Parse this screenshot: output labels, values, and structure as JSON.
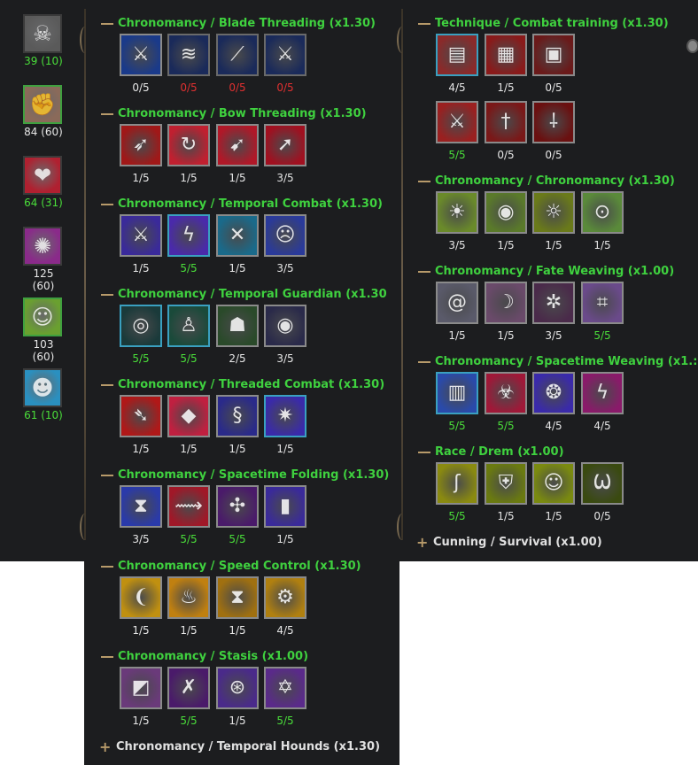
{
  "stats": [
    {
      "label": "39 (10)",
      "color": "green",
      "icon": "skull-emblem-icon",
      "bg": "#5a5a5a",
      "selected": false
    },
    {
      "label": "84 (60)",
      "color": "white",
      "icon": "fist-icon",
      "bg": "#8a6a5a",
      "selected": true
    },
    {
      "label": "64 (31)",
      "color": "green",
      "icon": "heart-drop-icon",
      "bg": "#b02030",
      "selected": false
    },
    {
      "label": "125 (60)",
      "color": "white",
      "icon": "magic-burst-icon",
      "bg": "#8a2a8a",
      "selected": false
    },
    {
      "label": "103 (60)",
      "color": "white",
      "icon": "meditating-figure-icon",
      "bg": "#6aa030",
      "selected": true
    },
    {
      "label": "61 (10)",
      "color": "green",
      "icon": "hooded-figure-icon",
      "bg": "#2a90c0",
      "selected": false
    }
  ],
  "left_categories": [
    {
      "title": "Chronomancy / Blade Threading (x1.30)",
      "talents": [
        {
          "icon": "sword-slash-icon",
          "value": "0/5",
          "color": "white",
          "bg": "#1a3a8a",
          "border": "#8a8a8a"
        },
        {
          "icon": "blade-wave-icon",
          "value": "0/5",
          "color": "red",
          "bg": "#1a2a5a",
          "border": "#6a6a6a"
        },
        {
          "icon": "twin-blades-icon",
          "value": "0/5",
          "color": "red",
          "bg": "#1a2a5a",
          "border": "#6a6a6a"
        },
        {
          "icon": "spinning-sword-icon",
          "value": "0/5",
          "color": "red",
          "bg": "#1a2a5a",
          "border": "#6a6a6a"
        }
      ]
    },
    {
      "title": "Chronomancy / Bow Threading (x1.30)",
      "talents": [
        {
          "icon": "archer-icon",
          "value": "1/5",
          "color": "white",
          "bg": "#a01818",
          "border": "#8a8a8a"
        },
        {
          "icon": "arrow-orbit-icon",
          "value": "1/5",
          "color": "white",
          "bg": "#c02030",
          "border": "#8a8a8a"
        },
        {
          "icon": "arrow-volley-icon",
          "value": "1/5",
          "color": "white",
          "bg": "#b01828",
          "border": "#8a8a8a"
        },
        {
          "icon": "arrow-strike-icon",
          "value": "3/5",
          "color": "white",
          "bg": "#a01020",
          "border": "#8a8a8a"
        }
      ]
    },
    {
      "title": "Chronomancy / Temporal Combat (x1.30)",
      "talents": [
        {
          "icon": "blue-sword-icon",
          "value": "1/5",
          "color": "white",
          "bg": "#3a2a9a",
          "border": "#8a8a8a"
        },
        {
          "icon": "lightning-claw-icon",
          "value": "5/5",
          "color": "green",
          "bg": "#4a2aaa",
          "border": "#3aa0c0"
        },
        {
          "icon": "crossed-blades-icon",
          "value": "1/5",
          "color": "white",
          "bg": "#1a6a8a",
          "border": "#8a8a8a"
        },
        {
          "icon": "spirit-face-icon",
          "value": "3/5",
          "color": "white",
          "bg": "#2a3a9a",
          "border": "#8a8a8a"
        }
      ]
    },
    {
      "title": "Chronomancy / Temporal Guardian (x1.30",
      "talents": [
        {
          "icon": "orbit-swirl-icon",
          "value": "5/5",
          "color": "green",
          "bg": "#1a3a3a",
          "border": "#3aa0c0"
        },
        {
          "icon": "glowing-figure-icon",
          "value": "5/5",
          "color": "green",
          "bg": "#1a4a3a",
          "border": "#3aa0c0"
        },
        {
          "icon": "green-mask-icon",
          "value": "2/5",
          "color": "white",
          "bg": "#2a4a2a",
          "border": "#8a8a8a"
        },
        {
          "icon": "watching-eye-icon",
          "value": "3/5",
          "color": "white",
          "bg": "#2a2a4a",
          "border": "#8a8a8a"
        }
      ]
    },
    {
      "title": "Chronomancy / Threaded Combat (x1.30)",
      "talents": [
        {
          "icon": "bow-blade-icon",
          "value": "1/5",
          "color": "white",
          "bg": "#b01818",
          "border": "#8a8a8a"
        },
        {
          "icon": "diamond-sigil-icon",
          "value": "1/5",
          "color": "white",
          "bg": "#c02040",
          "border": "#8a8a8a"
        },
        {
          "icon": "serpent-blade-icon",
          "value": "1/5",
          "color": "white",
          "bg": "#2a2a8a",
          "border": "#8a8a8a"
        },
        {
          "icon": "star-burst-icon",
          "value": "1/5",
          "color": "white",
          "bg": "#3a2aaa",
          "border": "#3aa0c0"
        }
      ]
    },
    {
      "title": "Chronomancy / Spacetime Folding (x1.30)",
      "talents": [
        {
          "icon": "hourglass-portal-icon",
          "value": "3/5",
          "color": "white",
          "bg": "#2a3aaa",
          "border": "#8a8a8a"
        },
        {
          "icon": "streak-icon",
          "value": "5/5",
          "color": "green",
          "bg": "#a01828",
          "border": "#8a8a8a"
        },
        {
          "icon": "scatter-arrows-icon",
          "value": "5/5",
          "color": "green",
          "bg": "#4a1a6a",
          "border": "#8a8a8a"
        },
        {
          "icon": "pillar-icon",
          "value": "1/5",
          "color": "white",
          "bg": "#3a2a9a",
          "border": "#8a8a8a"
        }
      ]
    },
    {
      "title": "Chronomancy / Speed Control (x1.30)",
      "talents": [
        {
          "icon": "winged-boot-icon",
          "value": "1/5",
          "color": "white",
          "bg": "#c09010",
          "border": "#8a8a8a"
        },
        {
          "icon": "slowed-figure-icon",
          "value": "1/5",
          "color": "white",
          "bg": "#c08010",
          "border": "#8a8a8a"
        },
        {
          "icon": "golden-hourglass-icon",
          "value": "1/5",
          "color": "white",
          "bg": "#a07010",
          "border": "#8a8a8a"
        },
        {
          "icon": "gear-hand-icon",
          "value": "4/5",
          "color": "white",
          "bg": "#b08010",
          "border": "#8a8a8a"
        }
      ]
    },
    {
      "title": "Chronomancy / Stasis (x1.00)",
      "talents": [
        {
          "icon": "stone-cube-icon",
          "value": "1/5",
          "color": "white",
          "bg": "#6a3a7a",
          "border": "#8a8a8a"
        },
        {
          "icon": "orbit-cross-icon",
          "value": "5/5",
          "color": "green",
          "bg": "#4a1a6a",
          "border": "#8a8a8a"
        },
        {
          "icon": "clock-gear-icon",
          "value": "1/5",
          "color": "white",
          "bg": "#4a2a8a",
          "border": "#8a8a8a"
        },
        {
          "icon": "star-seal-icon",
          "value": "5/5",
          "color": "green",
          "bg": "#5a2a8a",
          "border": "#8a8a8a"
        }
      ]
    }
  ],
  "left_collapsed": "Chronomancy / Temporal Hounds (x1.30)",
  "right_categories": [
    {
      "title": "Technique / Combat training (x1.30)",
      "rows": [
        [
          {
            "icon": "armored-arm-icon",
            "value": "4/5",
            "color": "white",
            "bg": "#8a2a2a",
            "border": "#3aa0c0"
          },
          {
            "icon": "chainmail-icon",
            "value": "1/5",
            "color": "white",
            "bg": "#8a1a1a",
            "border": "#8a8a8a"
          },
          {
            "icon": "breastplate-icon",
            "value": "0/5",
            "color": "white",
            "bg": "#6a1a1a",
            "border": "#8a8a8a"
          }
        ],
        [
          {
            "icon": "crossed-swords-icon",
            "value": "5/5",
            "color": "green",
            "bg": "#9a2020",
            "border": "#8a8a8a"
          },
          {
            "icon": "dagger-shield-icon",
            "value": "0/5",
            "color": "white",
            "bg": "#7a1818",
            "border": "#8a8a8a"
          },
          {
            "icon": "bloody-dagger-icon",
            "value": "0/5",
            "color": "white",
            "bg": "#6a1010",
            "border": "#8a8a8a"
          }
        ]
      ]
    },
    {
      "title": "Chronomancy / Chronomancy (x1.30)",
      "rows": [
        [
          {
            "icon": "radiant-figure-icon",
            "value": "3/5",
            "color": "white",
            "bg": "#6a8a2a",
            "border": "#8a8a8a"
          },
          {
            "icon": "all-seeing-eye-icon",
            "value": "1/5",
            "color": "white",
            "bg": "#5a7a2a",
            "border": "#8a8a8a"
          },
          {
            "icon": "sun-face-icon",
            "value": "1/5",
            "color": "white",
            "bg": "#6a7a1a",
            "border": "#8a8a8a"
          },
          {
            "icon": "mystic-eye-icon",
            "value": "1/5",
            "color": "white",
            "bg": "#5a8a3a",
            "border": "#8a8a8a"
          }
        ]
      ]
    },
    {
      "title": "Chronomancy / Fate Weaving (x1.00)",
      "rows": [
        [
          {
            "icon": "vortex-icon",
            "value": "1/5",
            "color": "white",
            "bg": "#5a5a6a",
            "border": "#8a8a8a"
          },
          {
            "icon": "reaper-icon",
            "value": "1/5",
            "color": "white",
            "bg": "#6a4a6a",
            "border": "#8a8a8a"
          },
          {
            "icon": "spider-icon",
            "value": "3/5",
            "color": "white",
            "bg": "#4a2a4a",
            "border": "#8a8a8a"
          },
          {
            "icon": "spider-web-icon",
            "value": "5/5",
            "color": "green",
            "bg": "#6a4a8a",
            "border": "#8a8a8a"
          }
        ]
      ]
    },
    {
      "title": "Chronomancy / Spacetime Weaving (x1.:",
      "rows": [
        [
          {
            "icon": "dimension-door-icon",
            "value": "5/5",
            "color": "green",
            "bg": "#2a4aaa",
            "border": "#3aa0c0"
          },
          {
            "icon": "biohazard-warp-icon",
            "value": "5/5",
            "color": "green",
            "bg": "#a01838",
            "border": "#8a8a8a"
          },
          {
            "icon": "rune-orb-icon",
            "value": "4/5",
            "color": "white",
            "bg": "#3a2aaa",
            "border": "#8a8a8a"
          },
          {
            "icon": "zigzag-bolt-icon",
            "value": "4/5",
            "color": "white",
            "bg": "#8a1a6a",
            "border": "#8a8a8a"
          }
        ]
      ]
    },
    {
      "title": "Race / Drem (x1.00)",
      "rows": [
        [
          {
            "icon": "claw-icon",
            "value": "5/5",
            "color": "green",
            "bg": "#8a8a10",
            "border": "#8a8a8a"
          },
          {
            "icon": "armor-vest-icon",
            "value": "1/5",
            "color": "white",
            "bg": "#6a7a10",
            "border": "#8a8a8a"
          },
          {
            "icon": "twin-masks-icon",
            "value": "1/5",
            "color": "white",
            "bg": "#7a8a10",
            "border": "#8a8a8a"
          },
          {
            "icon": "fanged-maw-icon",
            "value": "0/5",
            "color": "white",
            "bg": "#3a4a10",
            "border": "#8a8a8a"
          }
        ]
      ]
    }
  ],
  "right_collapsed": "Cunning / Survival (x1.00)",
  "glyphs": {
    "skull-emblem-icon": "☠",
    "fist-icon": "✊",
    "heart-drop-icon": "❤",
    "magic-burst-icon": "✺",
    "meditating-figure-icon": "☺",
    "hooded-figure-icon": "☻",
    "sword-slash-icon": "⚔",
    "blade-wave-icon": "≋",
    "twin-blades-icon": "⟋",
    "spinning-sword-icon": "⚔",
    "archer-icon": "➶",
    "arrow-orbit-icon": "↻",
    "arrow-volley-icon": "➹",
    "arrow-strike-icon": "➚",
    "blue-sword-icon": "⚔",
    "lightning-claw-icon": "ϟ",
    "crossed-blades-icon": "✕",
    "spirit-face-icon": "☹",
    "orbit-swirl-icon": "◎",
    "glowing-figure-icon": "♙",
    "green-mask-icon": "☗",
    "watching-eye-icon": "◉",
    "bow-blade-icon": "➴",
    "diamond-sigil-icon": "◆",
    "serpent-blade-icon": "§",
    "star-burst-icon": "✷",
    "hourglass-portal-icon": "⧗",
    "streak-icon": "⟿",
    "scatter-arrows-icon": "✣",
    "pillar-icon": "▮",
    "winged-boot-icon": "❨",
    "slowed-figure-icon": "♨",
    "golden-hourglass-icon": "⧗",
    "gear-hand-icon": "⚙",
    "stone-cube-icon": "◩",
    "orbit-cross-icon": "✗",
    "clock-gear-icon": "⊛",
    "star-seal-icon": "✡",
    "armored-arm-icon": "▤",
    "chainmail-icon": "▦",
    "breastplate-icon": "▣",
    "crossed-swords-icon": "⚔",
    "dagger-shield-icon": "†",
    "bloody-dagger-icon": "⸸",
    "radiant-figure-icon": "☀",
    "all-seeing-eye-icon": "◉",
    "sun-face-icon": "☼",
    "mystic-eye-icon": "⊙",
    "vortex-icon": "@",
    "reaper-icon": "☽",
    "spider-icon": "✲",
    "spider-web-icon": "⌗",
    "dimension-door-icon": "▥",
    "biohazard-warp-icon": "☣",
    "rune-orb-icon": "❂",
    "zigzag-bolt-icon": "ϟ",
    "claw-icon": "ʃ",
    "armor-vest-icon": "⛨",
    "twin-masks-icon": "☺",
    "fanged-maw-icon": "Ѡ"
  }
}
